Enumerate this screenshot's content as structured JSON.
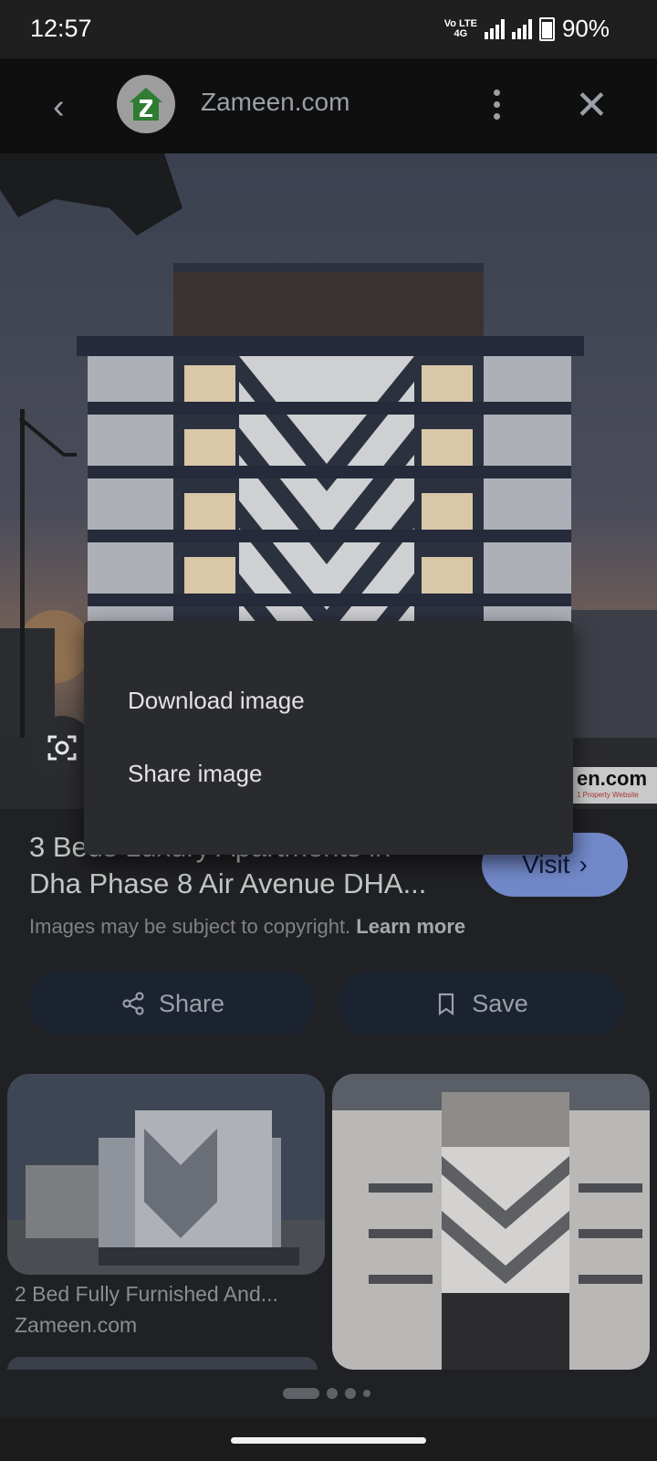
{
  "status_bar": {
    "time": "12:57",
    "network_top": "Vo LTE",
    "network_mid": "4G",
    "battery": "90%"
  },
  "browser": {
    "site_name": "Zameen.com"
  },
  "hero": {
    "watermark_text": "en.com",
    "watermark_sub": "1 Property Website"
  },
  "context_menu": {
    "items": [
      "Download image",
      "Share image"
    ]
  },
  "result": {
    "title_line1": "3 Beds Luxury Apartments in",
    "title_line2": "Dha Phase 8 Air Avenue DHA...",
    "visit_label": "Visit",
    "copyright_text": "Images may be subject to copyright.",
    "learn_more": "Learn more"
  },
  "actions": {
    "share_label": "Share",
    "save_label": "Save"
  },
  "related": [
    {
      "caption": "2 Bed Fully Furnished And...",
      "source": "Zameen.com"
    },
    {
      "caption": "",
      "source": ""
    }
  ],
  "colors": {
    "accent_button": "#7289c9",
    "scrim_background": "#202124",
    "menu_background": "#2a2b2f"
  }
}
